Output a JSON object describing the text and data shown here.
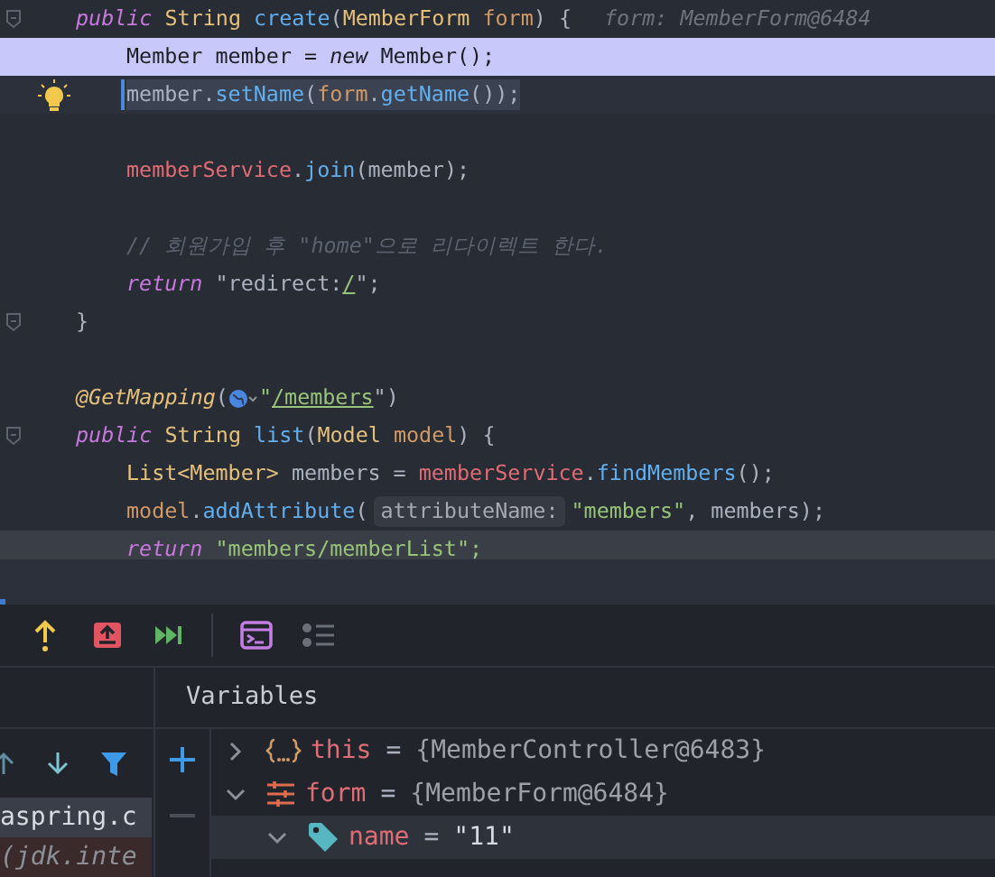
{
  "editor": {
    "lines": [
      {
        "fold": true,
        "bulb": false,
        "execution_point": false,
        "selected": false,
        "current": false,
        "tokens": [
          {
            "text": "public",
            "kind": "kw"
          },
          {
            "text": " String",
            "kind": "type"
          },
          {
            "text": " create",
            "kind": "fn"
          },
          {
            "text": "(",
            "kind": "plain"
          },
          {
            "text": "MemberForm",
            "kind": "type"
          },
          {
            "text": " form",
            "kind": "param"
          },
          {
            "text": ") {",
            "kind": "plain"
          },
          {
            "text": "form: MemberForm@6484",
            "kind": "hint"
          }
        ],
        "children": [
          {
            "fold": false,
            "bulb": false,
            "execution_point": true,
            "selected": false,
            "current": false,
            "tokens": [
              {
                "text": "Member member = ",
                "kind": "plain"
              },
              {
                "text": "new",
                "kind": "kwi"
              },
              {
                "text": " Member();",
                "kind": "plain"
              }
            ]
          },
          {
            "fold": false,
            "bulb": true,
            "execution_point": false,
            "selected": true,
            "current": false,
            "tokens": [
              {
                "text": "member.",
                "kind": "plain"
              },
              {
                "text": "setName",
                "kind": "fn"
              },
              {
                "text": "(",
                "kind": "plain"
              },
              {
                "text": "form",
                "kind": "param"
              },
              {
                "text": ".",
                "kind": "plain"
              },
              {
                "text": "getName",
                "kind": "fn"
              },
              {
                "text": "());",
                "kind": "plain"
              }
            ]
          },
          {
            "fold": false,
            "bulb": false,
            "execution_point": false,
            "selected": false,
            "current": false
          },
          {
            "fold": false,
            "bulb": false,
            "execution_point": false,
            "selected": false,
            "current": false,
            "tokens": [
              {
                "text": "memberService",
                "kind": "field"
              },
              {
                "text": ".",
                "kind": "plain"
              },
              {
                "text": "join",
                "kind": "fn"
              },
              {
                "text": "(member);",
                "kind": "plain"
              }
            ]
          },
          {
            "fold": false,
            "bulb": false,
            "execution_point": false,
            "selected": false,
            "current": false
          },
          {
            "fold": false,
            "bulb": false,
            "execution_point": false,
            "selected": false,
            "current": false,
            "tokens": [
              {
                "text": "// 회원가입 후 \"home\"으로 리다이렉트 한다.",
                "kind": "comment"
              }
            ]
          },
          {
            "fold": false,
            "bulb": false,
            "execution_point": false,
            "selected": false,
            "current": false,
            "tokens": [
              {
                "text": "return",
                "kind": "kw"
              },
              {
                "text": " \"redirect:",
                "kind": "plain"
              },
              {
                "text": "/",
                "kind": "link"
              },
              {
                "text": "\";",
                "kind": "plain"
              }
            ]
          }
        ]
      },
      {
        "fold": true,
        "bulb": false,
        "execution_point": false,
        "selected": false,
        "current": false,
        "tokens": [
          {
            "text": "}",
            "kind": "plain"
          }
        ]
      },
      {
        "fold": false,
        "bulb": false,
        "execution_point": false,
        "selected": false,
        "current": false
      },
      {
        "fold": false,
        "bulb": false,
        "execution_point": false,
        "selected": false,
        "current": false,
        "tokens": [
          {
            "text": "@GetMapping",
            "kind": "ann"
          },
          {
            "text": "(",
            "kind": "plain"
          },
          {
            "kind": "globe"
          },
          {
            "text": "\"",
            "kind": "str"
          },
          {
            "text": "/members",
            "kind": "link"
          },
          {
            "text": "\")",
            "kind": "plain"
          }
        ]
      },
      {
        "fold": true,
        "bulb": false,
        "execution_point": false,
        "selected": false,
        "current": false,
        "tokens": [
          {
            "text": "public",
            "kind": "kw"
          },
          {
            "text": " String",
            "kind": "type"
          },
          {
            "text": " list",
            "kind": "fn"
          },
          {
            "text": "(",
            "kind": "plain"
          },
          {
            "text": "Model",
            "kind": "type"
          },
          {
            "text": " model",
            "kind": "param"
          },
          {
            "text": ") {",
            "kind": "plain"
          }
        ],
        "children": [
          {
            "fold": false,
            "bulb": false,
            "execution_point": false,
            "selected": false,
            "current": false,
            "tokens": [
              {
                "text": "List<Member>",
                "kind": "type"
              },
              {
                "text": " members = ",
                "kind": "plain"
              },
              {
                "text": "memberService",
                "kind": "field"
              },
              {
                "text": ".",
                "kind": "plain"
              },
              {
                "text": "findMembers",
                "kind": "fn"
              },
              {
                "text": "();",
                "kind": "plain"
              }
            ]
          },
          {
            "fold": false,
            "bulb": false,
            "execution_point": false,
            "selected": false,
            "current": false,
            "tokens": [
              {
                "text": "model",
                "kind": "param"
              },
              {
                "text": ".",
                "kind": "plain"
              },
              {
                "text": "addAttribute",
                "kind": "fn"
              },
              {
                "text": "(",
                "kind": "plain"
              },
              {
                "text": "attributeName:",
                "kind": "inlay"
              },
              {
                "text": "\"members\"",
                "kind": "str"
              },
              {
                "text": ", members);",
                "kind": "plain"
              }
            ]
          },
          {
            "fold": false,
            "bulb": false,
            "execution_point": false,
            "selected": false,
            "current": true,
            "tokens": [
              {
                "text": "return",
                "kind": "kw"
              },
              {
                "text": " \"members/memberList\";",
                "kind": "str"
              }
            ]
          }
        ]
      }
    ]
  },
  "debug_toolbar": [
    {
      "kind": "step_out"
    },
    {
      "kind": "drop_frame"
    },
    {
      "kind": "resume"
    },
    {
      "kind": "separator"
    },
    {
      "kind": "console"
    },
    {
      "kind": "layout"
    }
  ],
  "frames": {
    "toolbar": [
      {
        "kind": "up"
      },
      {
        "kind": "down"
      },
      {
        "kind": "filter"
      }
    ],
    "items": [
      {
        "text": "aspring.c",
        "selected": true,
        "library": false
      },
      {
        "text": "(jdk.inte",
        "selected": false,
        "library": true
      }
    ]
  },
  "variables": {
    "title": "Variables",
    "side_buttons": [
      {
        "kind": "add"
      },
      {
        "kind": "remove"
      }
    ],
    "tree": [
      {
        "name": "this",
        "equals": "=",
        "value": "{MemberController@6483}",
        "kind": "object",
        "expanded": false,
        "selected": false
      },
      {
        "name": "form",
        "equals": "=",
        "value": "{MemberForm@6484}",
        "kind": "fields",
        "expanded": true,
        "selected": false,
        "children": [
          {
            "name": "name",
            "equals": "=",
            "value": "\"11\"",
            "kind": "tag",
            "expanded": true,
            "selected": true
          }
        ]
      }
    ]
  }
}
